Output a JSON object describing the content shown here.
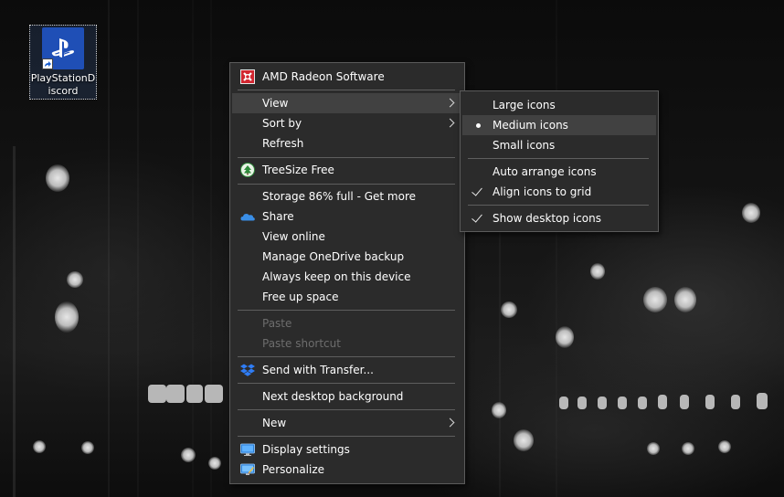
{
  "desktop": {
    "icon": {
      "label": "PlayStationDiscord"
    }
  },
  "context_menu": {
    "items": [
      {
        "label": "AMD Radeon Software",
        "icon": "amd-radeon-icon"
      },
      {
        "label": "View",
        "has_submenu": true,
        "highlighted": true
      },
      {
        "label": "Sort by",
        "has_submenu": true
      },
      {
        "label": "Refresh"
      },
      {
        "label": "TreeSize Free",
        "icon": "treesize-icon"
      },
      {
        "label": "Storage 86% full - Get more"
      },
      {
        "label": "Share",
        "icon": "onedrive-cloud-icon"
      },
      {
        "label": "View online"
      },
      {
        "label": "Manage OneDrive backup"
      },
      {
        "label": "Always keep on this device"
      },
      {
        "label": "Free up space"
      },
      {
        "label": "Paste",
        "disabled": true
      },
      {
        "label": "Paste shortcut",
        "disabled": true
      },
      {
        "label": "Send with Transfer...",
        "icon": "dropbox-icon"
      },
      {
        "label": "Next desktop background"
      },
      {
        "label": "New",
        "has_submenu": true
      },
      {
        "label": "Display settings",
        "icon": "display-settings-icon"
      },
      {
        "label": "Personalize",
        "icon": "personalize-icon"
      }
    ]
  },
  "view_submenu": {
    "items": [
      {
        "label": "Large icons"
      },
      {
        "label": "Medium icons",
        "selected": true,
        "highlighted": true
      },
      {
        "label": "Small icons"
      },
      {
        "label": "Auto arrange icons",
        "checked": false
      },
      {
        "label": "Align icons to grid",
        "checked": true
      },
      {
        "label": "Show desktop icons",
        "checked": true
      }
    ]
  },
  "colors": {
    "menu_bg": "#2b2b2b",
    "menu_highlight": "#414141",
    "disabled_text": "#6d6d6d",
    "playstation_blue": "#1f4fb6"
  }
}
